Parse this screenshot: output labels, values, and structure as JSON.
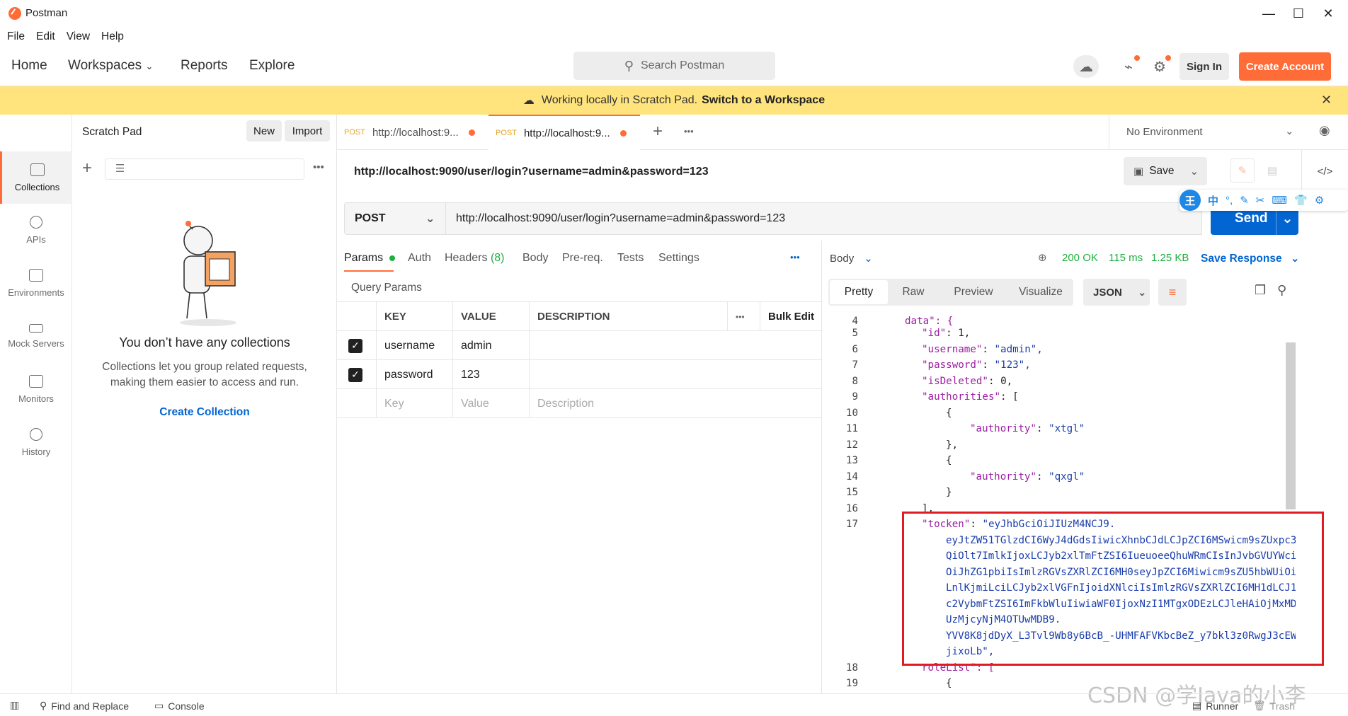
{
  "window": {
    "title": "Postman"
  },
  "menu": [
    "File",
    "Edit",
    "View",
    "Help"
  ],
  "nav": {
    "home": "Home",
    "workspaces": "Workspaces",
    "reports": "Reports",
    "explore": "Explore"
  },
  "search": {
    "placeholder": "Search Postman"
  },
  "auth": {
    "signin": "Sign In",
    "create": "Create Account"
  },
  "banner": {
    "text": "Working locally in Scratch Pad.",
    "link": "Switch to a Workspace"
  },
  "sidebar": {
    "items": [
      {
        "label": "Collections"
      },
      {
        "label": "APIs"
      },
      {
        "label": "Environments"
      },
      {
        "label": "Mock Servers"
      },
      {
        "label": "Monitors"
      },
      {
        "label": "History"
      }
    ]
  },
  "collections": {
    "title": "Scratch Pad",
    "new": "New",
    "import": "Import",
    "empty_title": "You don’t have any collections",
    "empty_line1": "Collections let you group related requests,",
    "empty_line2": "making them easier to access and run.",
    "create": "Create Collection"
  },
  "tabs": [
    {
      "method": "POST",
      "label": "http://localhost:9..."
    },
    {
      "method": "POST",
      "label": "http://localhost:9..."
    }
  ],
  "environment": {
    "selected": "No Environment"
  },
  "request": {
    "title": "http://localhost:9090/user/login?username=admin&password=123",
    "save": "Save",
    "method": "POST",
    "url": "http://localhost:9090/user/login?username=admin&password=123",
    "send": "Send",
    "subtabs": {
      "params": "Params",
      "auth": "Auth",
      "headers": "Headers",
      "headers_count": "(8)",
      "body": "Body",
      "prereq": "Pre-req.",
      "tests": "Tests",
      "settings": "Settings"
    },
    "query_params_label": "Query Params",
    "table": {
      "headers": {
        "key": "KEY",
        "value": "VALUE",
        "description": "DESCRIPTION",
        "bulk": "Bulk Edit"
      },
      "rows": [
        {
          "key": "username",
          "value": "admin"
        },
        {
          "key": "password",
          "value": "123"
        }
      ],
      "placeholder": {
        "key": "Key",
        "value": "Value",
        "description": "Description"
      }
    }
  },
  "response": {
    "body_label": "Body",
    "status": "200 OK",
    "time": "115 ms",
    "size": "1.25 KB",
    "save": "Save Response",
    "views": {
      "pretty": "Pretty",
      "raw": "Raw",
      "preview": "Preview",
      "visualize": "Visualize"
    },
    "format": "JSON"
  },
  "code": {
    "line4": "data\": {",
    "id_key": "\"id\"",
    "id_val": "1,",
    "username_key": "\"username\"",
    "username_val": "\"admin\",",
    "password_key": "\"password\"",
    "password_val": "\"123\",",
    "isDeleted_key": "\"isDeleted\"",
    "isDeleted_val": "0,",
    "authorities_key": "\"authorities\"",
    "authority_key": "\"authority\"",
    "authority1_val": "\"xtgl\"",
    "authority2_val": "\"qxgl\"",
    "token_key": "\"tocken\"",
    "token_lines": [
      "\"eyJhbGciOiJIUzM4NCJ9.",
      "eyJtZW51TGlzdCI6WyJ4dGdsIiwicXhnbCJdLCJpZCI6MSwicm9sZUxpc3",
      "QiOlt7ImlkIjoxLCJyb2xlTmFtZSI6IueuoeeQhuWRmCIsInJvbGVUYWci",
      "OiJhZG1pbiIsImlzRGVsZXRlZCI6MH0seyJpZCI6Miwicm9sZU5hbWUiOi",
      "LnlKjmiLciLCJyb2xlVGFnIjoidXNlciIsImlzRGVsZXRlZCI6MH1dLCJ1",
      "c2VybmFtZSI6ImFkbWluIiwiaWF0IjoxNzI1MTgxODEzLCJleHAiOjMxMD",
      "UzMjcyNjM4OTUwMDB9.",
      "YVV8K8jdDyX_L3Tvl9Wb8y6BcB_-UHMFAFVKbcBeZ_y7bkl3z0RwgJ3cEW",
      "jixoLb\","
    ],
    "rolelist": "roleList\": [",
    "line_numbers": [
      "4",
      "5",
      "6",
      "7",
      "8",
      "9",
      "10",
      "11",
      "12",
      "13",
      "14",
      "15",
      "16",
      "17",
      "18",
      "19"
    ]
  },
  "footer": {
    "find": "Find and Replace",
    "console": "Console",
    "runner": "Runner",
    "trash": "Trash"
  },
  "watermark": "CSDN @学Java的小李",
  "colors": {
    "accent": "#ff6c37",
    "send": "#0265d2",
    "banner": "#ffe47e",
    "highlight": "#e11b22"
  }
}
